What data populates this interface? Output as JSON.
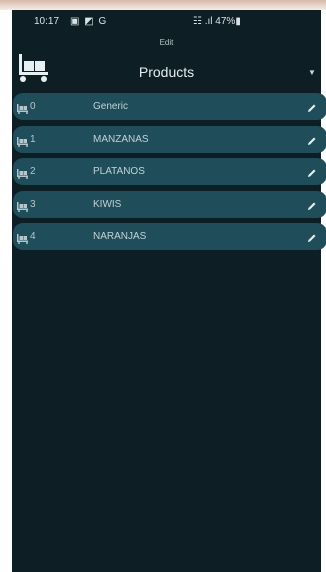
{
  "status_bar": {
    "time": "10:17",
    "left_icons": "▣ ◩ G",
    "right_text": "☷ .ıl 47%▮"
  },
  "header": {
    "edit_label": "Edit",
    "title": "Products"
  },
  "products": [
    {
      "id": "0",
      "name": "Generic"
    },
    {
      "id": "1",
      "name": "MANZANAS"
    },
    {
      "id": "2",
      "name": "PLATANOS"
    },
    {
      "id": "3",
      "name": "KIWIS"
    },
    {
      "id": "4",
      "name": "NARANJAS"
    }
  ],
  "colors": {
    "background": "#0d1f24",
    "row": "#204d5a",
    "text": "#c1d2d6"
  },
  "icons": {
    "logo": "cart-icon",
    "row": "cart-icon",
    "edit": "pencil-icon",
    "dropdown": "caret-down-icon"
  }
}
